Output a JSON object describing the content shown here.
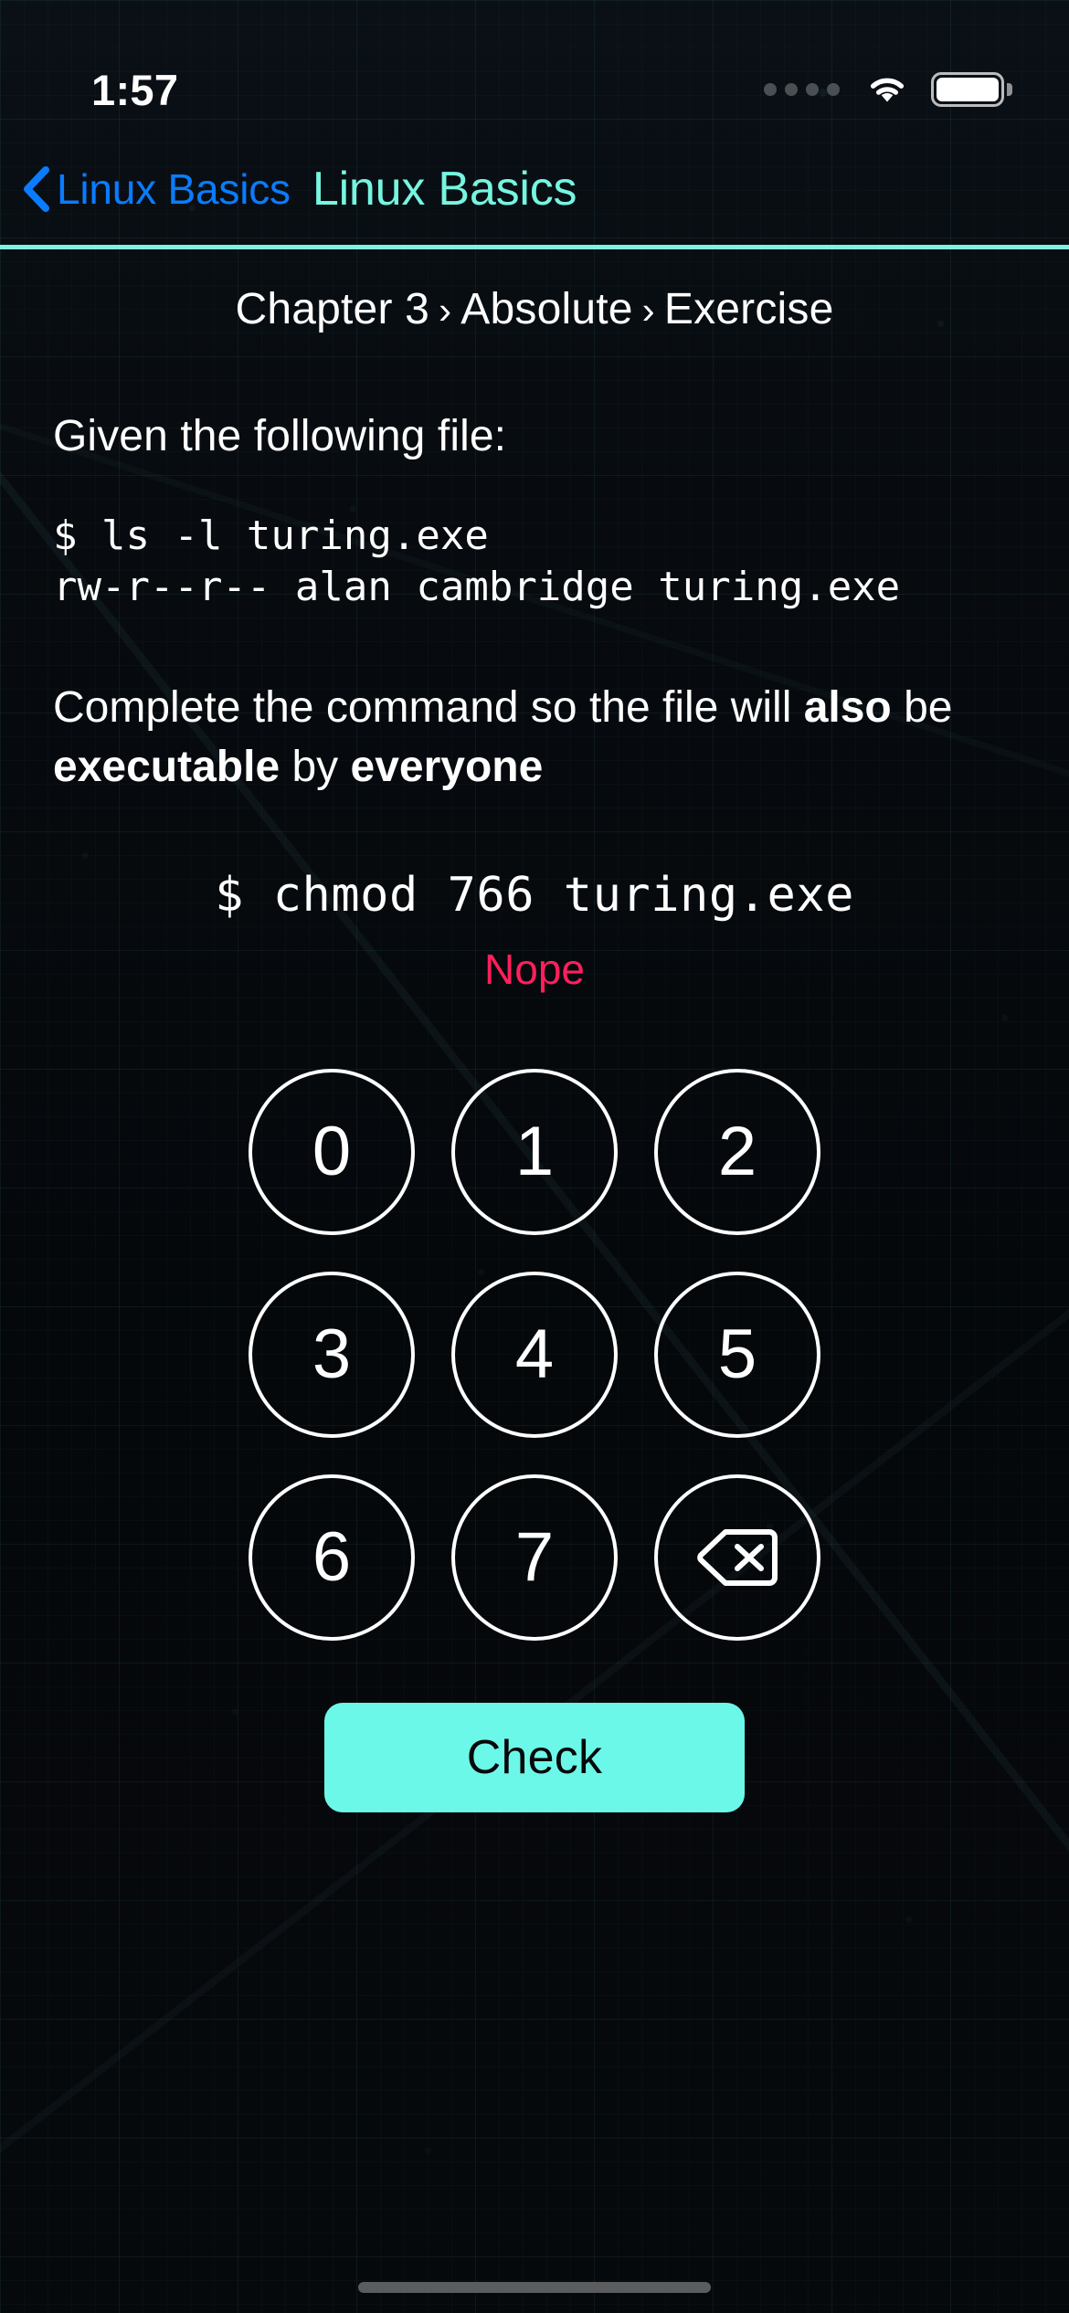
{
  "status_bar": {
    "time": "1:57",
    "signal_icon": "signal-dots-icon",
    "wifi_icon": "wifi-icon",
    "battery_icon": "battery-full-icon"
  },
  "nav": {
    "back_icon": "chevron-left-icon",
    "back_label": "Linux Basics",
    "title": "Linux Basics",
    "back_color": "#0a7cff",
    "title_color": "#76f5e0",
    "divider_color": "#7ff2e0"
  },
  "breadcrumb": {
    "items": [
      "Chapter 3",
      "Absolute",
      "Exercise"
    ],
    "separator": "›",
    "full": "Chapter 3 › Absolute › Exercise"
  },
  "exercise": {
    "prompt": "Given the following file:",
    "terminal": [
      "$ ls -l turing.exe",
      "rw-r--r-- alan cambridge turing.exe"
    ],
    "instruction_parts": [
      {
        "text": "Complete the command so the file will ",
        "bold": false
      },
      {
        "text": "also",
        "bold": true
      },
      {
        "text": " be ",
        "bold": false
      },
      {
        "text": "executable",
        "bold": true
      },
      {
        "text": " by ",
        "bold": false
      },
      {
        "text": "everyone",
        "bold": true
      }
    ],
    "answer_line": "$ chmod 766 turing.exe",
    "answer_value": "766",
    "feedback": "Nope",
    "feedback_color": "#ff1f5c"
  },
  "keypad": {
    "keys": [
      {
        "label": "0",
        "name": "key-0",
        "type": "digit"
      },
      {
        "label": "1",
        "name": "key-1",
        "type": "digit"
      },
      {
        "label": "2",
        "name": "key-2",
        "type": "digit"
      },
      {
        "label": "3",
        "name": "key-3",
        "type": "digit"
      },
      {
        "label": "4",
        "name": "key-4",
        "type": "digit"
      },
      {
        "label": "5",
        "name": "key-5",
        "type": "digit"
      },
      {
        "label": "6",
        "name": "key-6",
        "type": "digit"
      },
      {
        "label": "7",
        "name": "key-7",
        "type": "digit"
      },
      {
        "label": "",
        "name": "key-backspace",
        "type": "backspace",
        "icon": "backspace-icon"
      }
    ]
  },
  "check_button": {
    "label": "Check",
    "background": "#6cf8e8",
    "text_color": "#06080a"
  },
  "home_indicator": {
    "name": "home-indicator"
  }
}
